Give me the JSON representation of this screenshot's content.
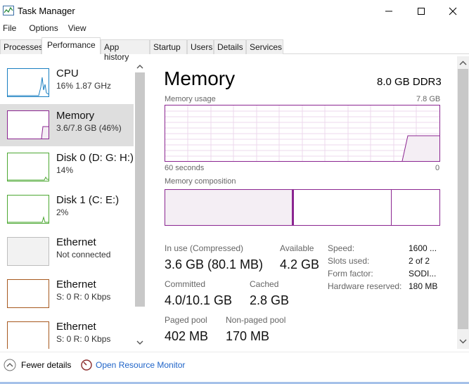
{
  "window": {
    "title": "Task Manager"
  },
  "menu": [
    "File",
    "Options",
    "View"
  ],
  "tabs": [
    {
      "label": "Processes"
    },
    {
      "label": "Performance"
    },
    {
      "label": "App history"
    },
    {
      "label": "Startup"
    },
    {
      "label": "Users"
    },
    {
      "label": "Details"
    },
    {
      "label": "Services"
    }
  ],
  "active_tab": "Performance",
  "sidebar": {
    "items": [
      {
        "name": "CPU",
        "sub": "16%  1.87 GHz",
        "color": "#1a7fc1",
        "selected": false
      },
      {
        "name": "Memory",
        "sub": "3.6/7.8 GB (46%)",
        "color": "#8b2591",
        "selected": true
      },
      {
        "name": "Disk 0 (D: G: H:)",
        "sub": "14%",
        "color": "#4da833",
        "selected": false
      },
      {
        "name": "Disk 1 (C: E:)",
        "sub": "2%",
        "color": "#4da833",
        "selected": false
      },
      {
        "name": "Ethernet",
        "sub": "Not connected",
        "color": "#bdbdbd",
        "selected": false
      },
      {
        "name": "Ethernet",
        "sub": "S: 0 R: 0 Kbps",
        "color": "#a7591f",
        "selected": false
      },
      {
        "name": "Ethernet",
        "sub": "S: 0 R: 0 Kbps",
        "color": "#a7591f",
        "selected": false
      }
    ]
  },
  "main": {
    "title": "Memory",
    "spec": "8.0 GB DDR3",
    "usage_label": "Memory usage",
    "usage_max": "7.8 GB",
    "time_left": "60 seconds",
    "time_right": "0",
    "composition_label": "Memory composition",
    "stats": {
      "in_use_label": "In use (Compressed)",
      "in_use_value": "3.6 GB (80.1 MB)",
      "available_label": "Available",
      "available_value": "4.2 GB",
      "committed_label": "Committed",
      "committed_value": "4.0/10.1 GB",
      "cached_label": "Cached",
      "cached_value": "2.8 GB",
      "paged_label": "Paged pool",
      "paged_value": "402 MB",
      "nonpaged_label": "Non-paged pool",
      "nonpaged_value": "170 MB"
    },
    "specs": [
      {
        "label": "Speed:",
        "value": "1600 ..."
      },
      {
        "label": "Slots used:",
        "value": "2 of 2"
      },
      {
        "label": "Form factor:",
        "value": "SODI..."
      },
      {
        "label": "Hardware reserved:",
        "value": "180 MB"
      }
    ]
  },
  "footer": {
    "fewer_details": "Fewer details",
    "open_resource_monitor": "Open Resource Monitor"
  },
  "colors": {
    "memory_accent": "#8b2591",
    "memory_fill": "#f4eef4",
    "link": "#1f64c8"
  }
}
